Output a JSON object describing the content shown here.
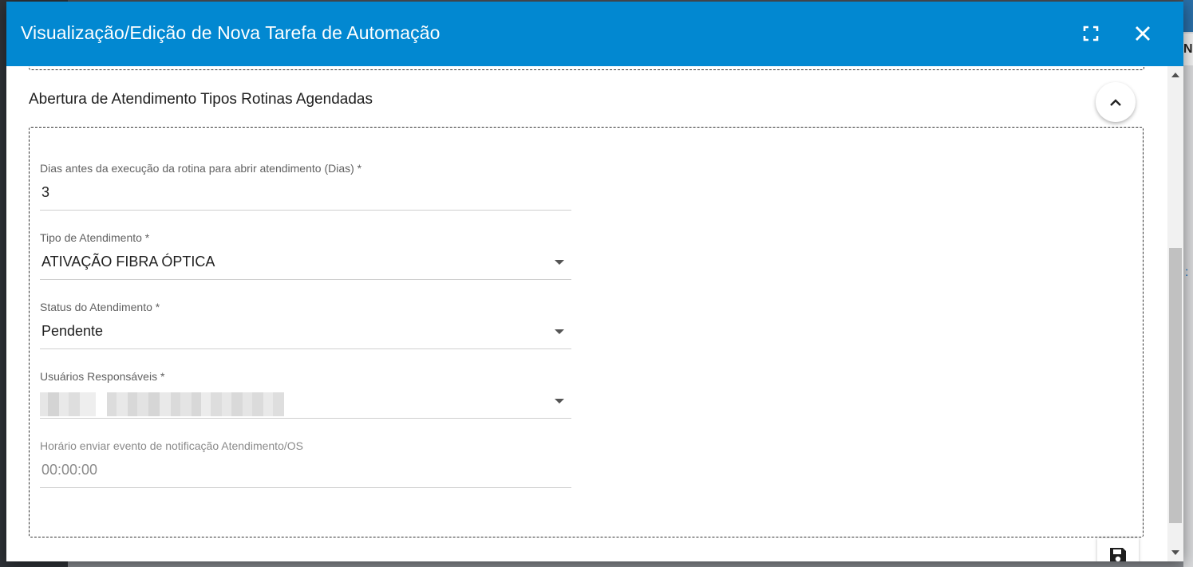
{
  "dialog": {
    "title": "Visualização/Edição de Nova Tarefa de Automação",
    "fullscreen_icon": "fullscreen-icon",
    "close_icon": "close-icon"
  },
  "section": {
    "title": "Abertura de Atendimento Tipos Rotinas Agendadas",
    "collapse_icon": "chevron-up-icon"
  },
  "fields": {
    "days_before": {
      "label": "Dias antes da execução da rotina para abrir atendimento (Dias) *",
      "value": "3"
    },
    "ticket_type": {
      "label": "Tipo de Atendimento *",
      "value": "ATIVAÇÃO FIBRA ÓPTICA"
    },
    "ticket_status": {
      "label": "Status do Atendimento *",
      "value": "Pendente"
    },
    "responsible_users": {
      "label": "Usuários Responsáveis *"
    },
    "notify_time": {
      "label": "Horário enviar evento de notificação Atendimento/OS",
      "value": "00:00:00"
    }
  },
  "actions": {
    "save_icon": "save-icon"
  },
  "colors": {
    "header": "#0288d1",
    "header_text": "#ffffff",
    "text": "#212121",
    "label": "#616161"
  }
}
